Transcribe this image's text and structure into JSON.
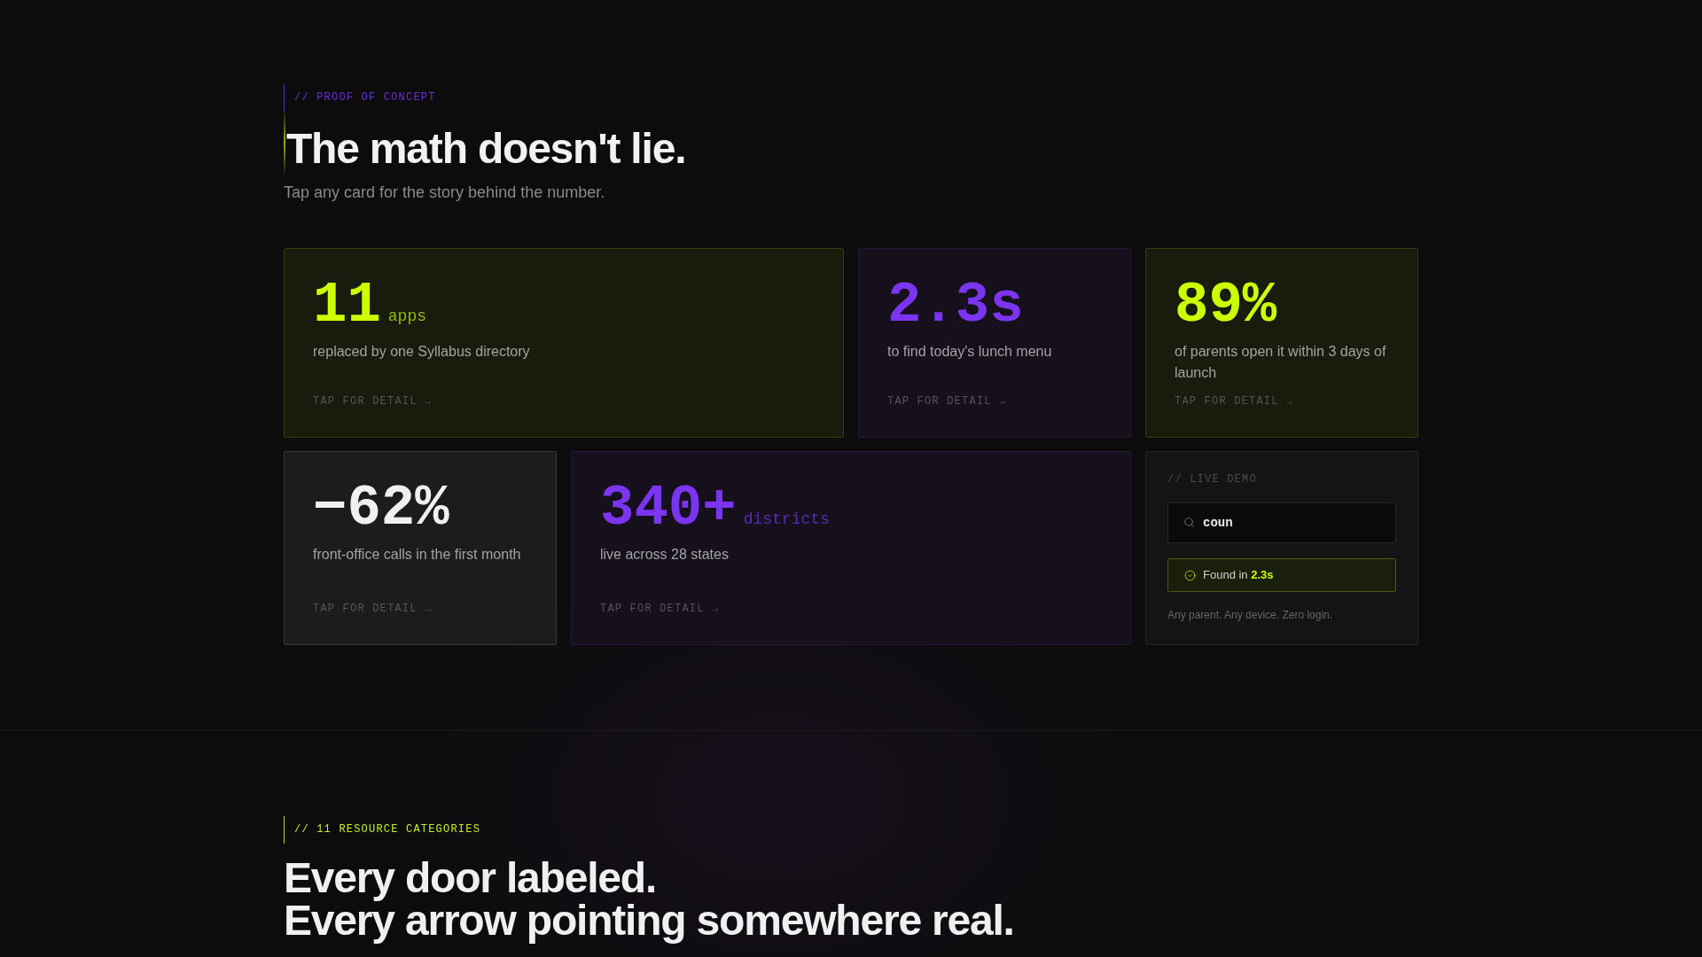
{
  "proof_section": {
    "eyebrow": "// PROOF OF CONCEPT",
    "title": "The math doesn't lie.",
    "subtitle": "Tap any card for the story behind the number."
  },
  "stat_cards": [
    {
      "value": "11",
      "unit": "apps",
      "description": "replaced by one Syllabus directory",
      "hint": "TAP FOR DETAIL →",
      "color": "#ccff00",
      "wide": true
    },
    {
      "value": "2.3s",
      "description": "to find today's lunch menu",
      "hint": "TAP FOR DETAIL →",
      "color": "#7b35f0",
      "wide": false
    },
    {
      "value": "89%",
      "description": "of parents open it within 3 days of launch",
      "hint": "TAP FOR DETAIL →",
      "color": "#ccff00",
      "wide": false
    },
    {
      "value": "−62%",
      "description": "front-office calls in the first month",
      "hint": "TAP FOR DETAIL →",
      "color": "#f0f0f0",
      "wide": false
    },
    {
      "value": "340+",
      "unit": "districts",
      "description": "live across 28 states",
      "hint": "TAP FOR DETAIL →",
      "color": "#7b35f0",
      "wide": true
    }
  ],
  "live_demo": {
    "label": "// LIVE DEMO",
    "search": {
      "value": "coun"
    },
    "result": "Found in **2.3s**",
    "caption": "Any parent. Any device. Zero login."
  },
  "categories_section": {
    "eyebrow": "// 11 RESOURCE CATEGORIES",
    "title": [
      "Every door labeled.",
      "Every arrow pointing somewhere real."
    ]
  }
}
